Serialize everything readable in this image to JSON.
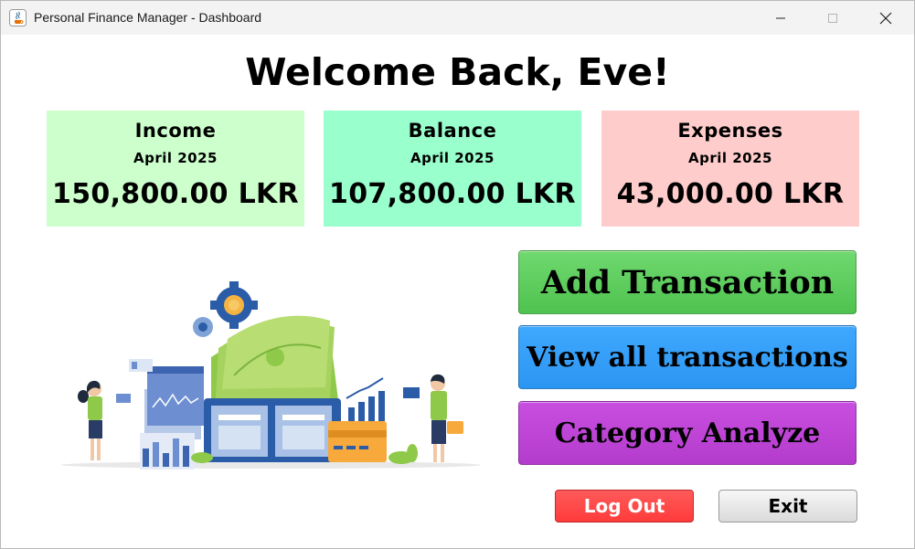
{
  "window": {
    "title": "Personal Finance Manager - Dashboard",
    "controls": [
      "minimize",
      "maximize",
      "close"
    ]
  },
  "welcome": "Welcome Back, Eve!",
  "cards": {
    "income": {
      "title": "Income",
      "period": "April 2025",
      "amount": "150,800.00 LKR",
      "color": "#ccffcc"
    },
    "balance": {
      "title": "Balance",
      "period": "April 2025",
      "amount": "107,800.00 LKR",
      "color": "#99ffcc"
    },
    "expenses": {
      "title": "Expenses",
      "period": "April 2025",
      "amount": "43,000.00 LKR",
      "color": "#ffcccc"
    }
  },
  "actions": {
    "add_transaction": "Add Transaction",
    "view_all": "View all transactions",
    "category_analyze": "Category Analyze"
  },
  "footer": {
    "logout": "Log Out",
    "exit": "Exit"
  },
  "illustration": {
    "icons": [
      "gear-icon",
      "money-stack",
      "wallet",
      "credit-card",
      "bar-chart",
      "people"
    ]
  }
}
